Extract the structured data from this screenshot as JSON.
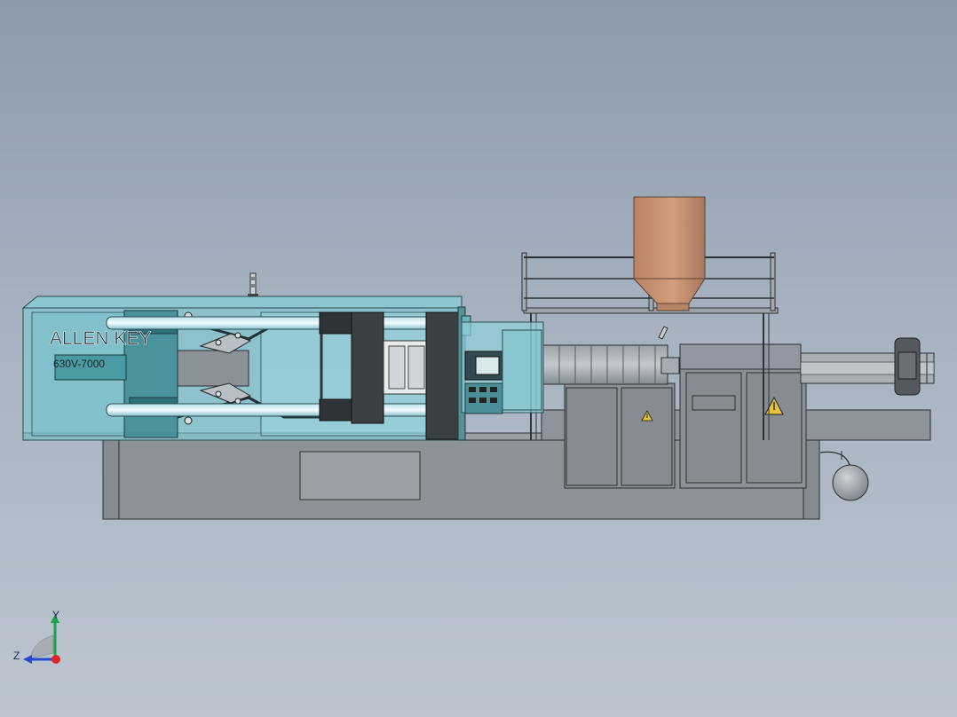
{
  "machine": {
    "brand": "ALLEN KEY",
    "model": "630V-7000"
  },
  "triad": {
    "y_label": "Y",
    "z_label": "Z"
  },
  "colors": {
    "background_top": "#8c9aab",
    "background_bottom": "#bcc5cf",
    "guard_teal": "#6fc4cf",
    "platen_dark": "#3a3f42",
    "base_gray": "#8d9299",
    "hopper_copper": "#c8916c"
  },
  "icons": [
    "warning-triangle-icon",
    "coordinate-triad-icon",
    "signal-tower-icon",
    "control-panel-icon"
  ]
}
